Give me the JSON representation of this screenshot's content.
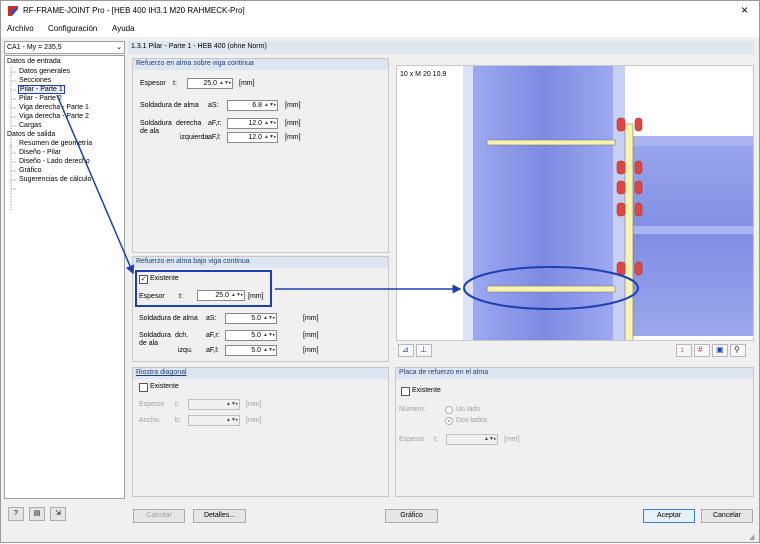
{
  "window": {
    "title": "RF-FRAME-JOINT Pro - [HEB 400 IH3.1 M20 RAHMECK-Pro]",
    "close_glyph": "×"
  },
  "menu": [
    "Archivo",
    "Configuración",
    "Ayuda"
  ],
  "load_case": "CA1 - My = 235,5",
  "section_title": "1.3.1 Pilar - Parte 1 - HEB 400 (ohne Norm)",
  "tree": {
    "input_root": "Datos de entrada",
    "input_items": [
      "Datos generales",
      "Secciones",
      "Pilar - Parte 1",
      "Pilar - Parte 2",
      "Viga derecha - Parte 1",
      "Viga derecha - Parte 2",
      "Cargas"
    ],
    "output_root": "Datos de salida",
    "output_items": [
      "Resumen de geometría",
      "Diseño - Pilar",
      "Diseño - Lado derecho",
      "Gráfico",
      "Sugerencias de cálculo"
    ],
    "selected": "Pilar - Parte 1"
  },
  "above": {
    "header": "Refuerzo en alma sobre viga continua",
    "thickness_label": "Espesor",
    "thickness_symbol": "t:",
    "thickness_value": "25.0",
    "thickness_unit": "[mm]",
    "web_weld_label": "Soldadura de alma",
    "web_weld_symbol": "aS:",
    "web_weld_value": "6.8",
    "web_weld_unit": "[mm]",
    "flange_weld_label1": "Soldadura",
    "flange_weld_label2": "de ala",
    "right_label": "derecha",
    "right_symbol": "aF,r:",
    "right_value": "12.0",
    "right_unit": "[mm]",
    "left_label": "izquierda",
    "left_symbol": "aF,l:",
    "left_value": "12.0",
    "left_unit": "[mm]"
  },
  "below": {
    "header": "Refuerzo en alma bajo viga continua",
    "exists_label": "Existente",
    "exists_checked": true,
    "thickness_label": "Espesor",
    "thickness_symbol": "t:",
    "thickness_value": "25.0",
    "thickness_unit": "[mm]",
    "web_weld_label": "Soldadura de alma",
    "web_weld_symbol": "aS:",
    "web_weld_value": "5.0",
    "web_weld_unit": "[mm]",
    "flange_weld_label1": "Soldadura",
    "flange_weld_label2": "de ala",
    "right_label": "dch.",
    "right_symbol": "aF,r:",
    "right_value": "5.0",
    "right_unit": "[mm]",
    "left_label": "izqu.",
    "left_symbol": "aF,l:",
    "left_value": "5.0",
    "left_unit": "[mm]"
  },
  "diagonal": {
    "header": "Riostra diagonal",
    "exists_label": "Existente",
    "thickness_label": "Espesor",
    "thickness_symbol": "t:",
    "thickness_unit": "[mm]",
    "width_label": "Ancho",
    "width_symbol": "b:",
    "width_unit": "[mm]"
  },
  "plate": {
    "header": "Placa de refuerzo en el alma",
    "exists_label": "Existente",
    "number_label": "Número:",
    "one_side": "Un lado",
    "two_sides": "Dos lados",
    "thickness_label": "Espesor",
    "thickness_symbol": "t:",
    "thickness_unit": "[mm]"
  },
  "graphic": {
    "bolt_label": "10 x M 20 10.9"
  },
  "buttons": {
    "calculate": "Calcular",
    "details": "Detalles...",
    "graphic": "Gráfico",
    "accept": "Aceptar",
    "cancel": "Cancelar"
  },
  "colors": {
    "accent_blue": "#1e3fb3",
    "steel_blue": "#6f7fe0",
    "stiffener_yellow": "#f7f3b0",
    "bolt_red": "#e0463f"
  }
}
